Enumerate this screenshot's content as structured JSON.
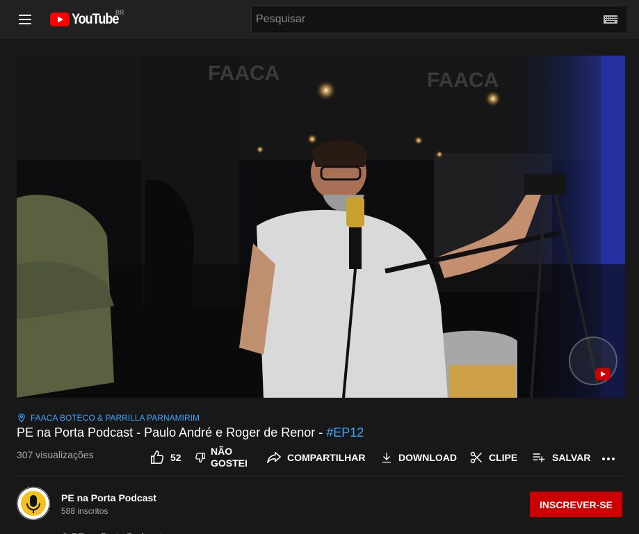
{
  "masthead": {
    "logo_text": "YouTube",
    "country_code": "BR",
    "search_placeholder": "Pesquisar"
  },
  "video": {
    "location": "FAACA BOTECO & PARRILLA PARNAMIRIM",
    "title": "PE na Porta Podcast - Paulo André e Roger de Renor - ",
    "hashtag": "#EP12",
    "views": "307 visualizações"
  },
  "actions": {
    "likes": "52",
    "dislike_line1": "NÃO",
    "dislike_line2": "GOSTEI",
    "share": "COMPARTILHAR",
    "download": "DOWNLOAD",
    "clip": "CLIPE",
    "save": "SALVAR"
  },
  "channel": {
    "name": "PE na Porta Podcast",
    "subscribers": "588 inscritos",
    "subscribe_label": "INSCREVER-SE"
  },
  "description": {
    "preview": "O PE na Porta Podcast"
  },
  "colors": {
    "background": "#181818",
    "masthead": "#212121",
    "accent_blue": "#3ea6ff",
    "subscribe_red": "#cc0000",
    "logo_red": "#ff0000"
  }
}
